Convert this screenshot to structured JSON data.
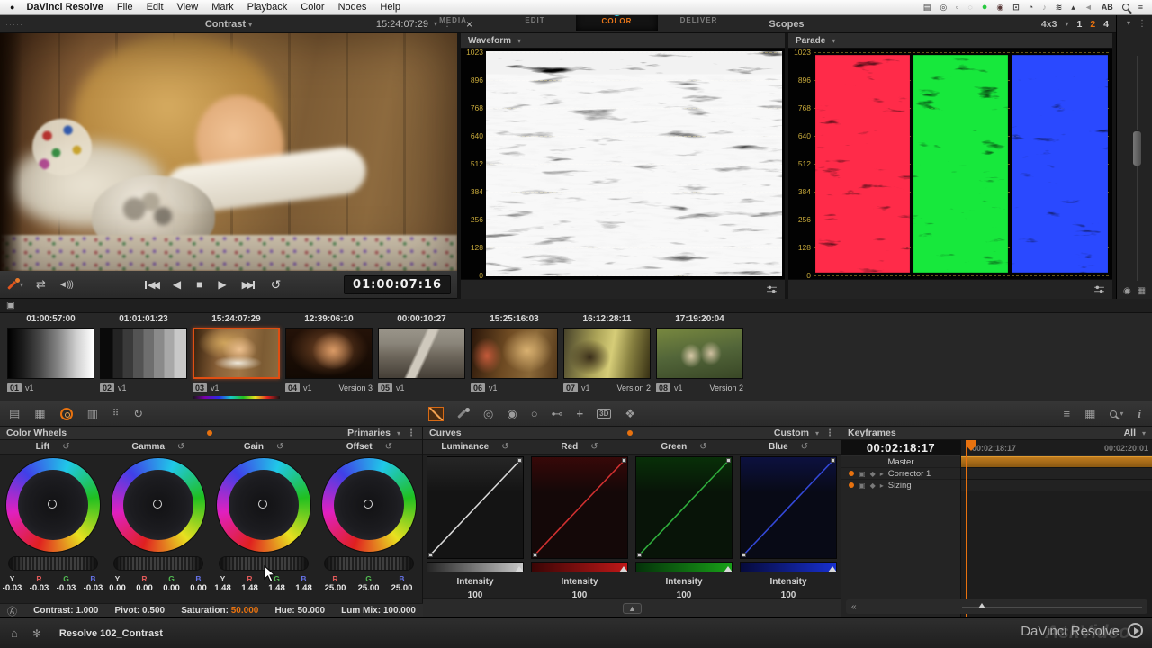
{
  "menubar": {
    "items": [
      "DaVinci Resolve",
      "File",
      "Edit",
      "View",
      "Mark",
      "Playback",
      "Color",
      "Nodes",
      "Help"
    ],
    "ab": "AB"
  },
  "icons": {
    "apple": "●",
    "camera": "▤",
    "target": "◎",
    "keyboard": "▫",
    "swirl": "◌",
    "green_app": "●",
    "eye": "◉",
    "displays": "⊡",
    "clock": "◔",
    "music": "♪",
    "wifi": "≋",
    "eject": "▴",
    "volume": "◄",
    "list": "≡",
    "dots_handle": "·····",
    "dropdown": "▾",
    "kebab": "⋮",
    "close": "×",
    "bypass": "⇄",
    "speaker": "◄)))",
    "step_back": "◀",
    "stop": "■",
    "play": "▶",
    "skip_back": "◀◀",
    "skip_fwd": "▶▶",
    "loop": "↺",
    "gallery": "▣",
    "clips": "▤",
    "grid": "▦",
    "mixer": "▥",
    "motion": "⠿",
    "stereo": "↻",
    "qualifier": "◎",
    "window_circle": "◉",
    "window_oval": "○",
    "key": "⊷",
    "tracker": "+",
    "threed": "3D",
    "blur": "❖",
    "filter": "≡",
    "info": "i",
    "reset": "↺",
    "lock": "▣",
    "diamond": "◆",
    "expand": "▸",
    "collapse": "«",
    "home": "⌂",
    "gear": "✻",
    "media": "▥",
    "edit": "⊞",
    "deliver": "⊠",
    "curve_tool": "▲",
    "circled_a": "Ⓐ"
  },
  "viewer": {
    "title": "Contrast",
    "timecode": "15:24:07:29",
    "transport_timecode": "01:00:07:16"
  },
  "scopes": {
    "title": "Scopes",
    "aspect": "4x3",
    "layout_one": "1",
    "layout_two": "2",
    "layout_four": "4",
    "left_type": "Waveform",
    "right_type": "Parade",
    "ticks": [
      "1023",
      "896",
      "768",
      "640",
      "512",
      "384",
      "256",
      "128",
      "0"
    ]
  },
  "timeline": {
    "clips": [
      {
        "timecode": "01:00:57:00",
        "num": "01",
        "version": "v1",
        "extra": ""
      },
      {
        "timecode": "01:01:01:23",
        "num": "02",
        "version": "v1",
        "extra": ""
      },
      {
        "timecode": "15:24:07:29",
        "num": "03",
        "version": "v1",
        "extra": ""
      },
      {
        "timecode": "12:39:06:10",
        "num": "04",
        "version": "v1",
        "extra": "Version 3"
      },
      {
        "timecode": "00:00:10:27",
        "num": "05",
        "version": "v1",
        "extra": ""
      },
      {
        "timecode": "15:25:16:03",
        "num": "06",
        "version": "v1",
        "extra": ""
      },
      {
        "timecode": "16:12:28:11",
        "num": "07",
        "version": "v1",
        "extra": "Version 2"
      },
      {
        "timecode": "17:19:20:04",
        "num": "08",
        "version": "v1",
        "extra": "Version 2"
      }
    ]
  },
  "color_wheels": {
    "title": "Color Wheels",
    "mode": "Primaries",
    "wheels": [
      {
        "name": "Lift",
        "channels": [
          {
            "l": "Y",
            "v": "-0.03"
          },
          {
            "l": "R",
            "v": "-0.03"
          },
          {
            "l": "G",
            "v": "-0.03"
          },
          {
            "l": "B",
            "v": "-0.03"
          }
        ]
      },
      {
        "name": "Gamma",
        "channels": [
          {
            "l": "Y",
            "v": "0.00"
          },
          {
            "l": "R",
            "v": "0.00"
          },
          {
            "l": "G",
            "v": "0.00"
          },
          {
            "l": "B",
            "v": "0.00"
          }
        ]
      },
      {
        "name": "Gain",
        "channels": [
          {
            "l": "Y",
            "v": "1.48"
          },
          {
            "l": "R",
            "v": "1.48"
          },
          {
            "l": "G",
            "v": "1.48"
          },
          {
            "l": "B",
            "v": "1.48"
          }
        ]
      },
      {
        "name": "Offset",
        "channels": [
          {
            "l": "R",
            "v": "25.00"
          },
          {
            "l": "G",
            "v": "25.00"
          },
          {
            "l": "B",
            "v": "25.00"
          }
        ]
      }
    ],
    "adjustments": [
      {
        "label": "Contrast:",
        "value": "1.000"
      },
      {
        "label": "Pivot:",
        "value": "0.500"
      },
      {
        "label": "Saturation:",
        "value": "50.000"
      },
      {
        "label": "Hue:",
        "value": "50.000"
      },
      {
        "label": "Lum Mix:",
        "value": "100.000"
      }
    ]
  },
  "curves": {
    "title": "Curves",
    "mode": "Custom",
    "items": [
      {
        "name": "Luminance",
        "intensity_label": "Intensity",
        "intensity": "100"
      },
      {
        "name": "Red",
        "intensity_label": "Intensity",
        "intensity": "100"
      },
      {
        "name": "Green",
        "intensity_label": "Intensity",
        "intensity": "100"
      },
      {
        "name": "Blue",
        "intensity_label": "Intensity",
        "intensity": "100"
      }
    ]
  },
  "keyframes": {
    "title": "Keyframes",
    "filter": "All",
    "current_timecode": "00:02:18:17",
    "ruler_start": "00:02:18:17",
    "ruler_end": "00:02:20:01",
    "tracks": [
      "Master",
      "Corrector 1",
      "Sizing"
    ]
  },
  "bottom_bar": {
    "project": "Resolve 102_Contrast",
    "pages": [
      {
        "label": "MEDIA"
      },
      {
        "label": "EDIT"
      },
      {
        "label": "COLOR"
      },
      {
        "label": "DELIVER"
      }
    ],
    "brand": "DaVinci Resolve",
    "watermark": "AskVideo"
  }
}
